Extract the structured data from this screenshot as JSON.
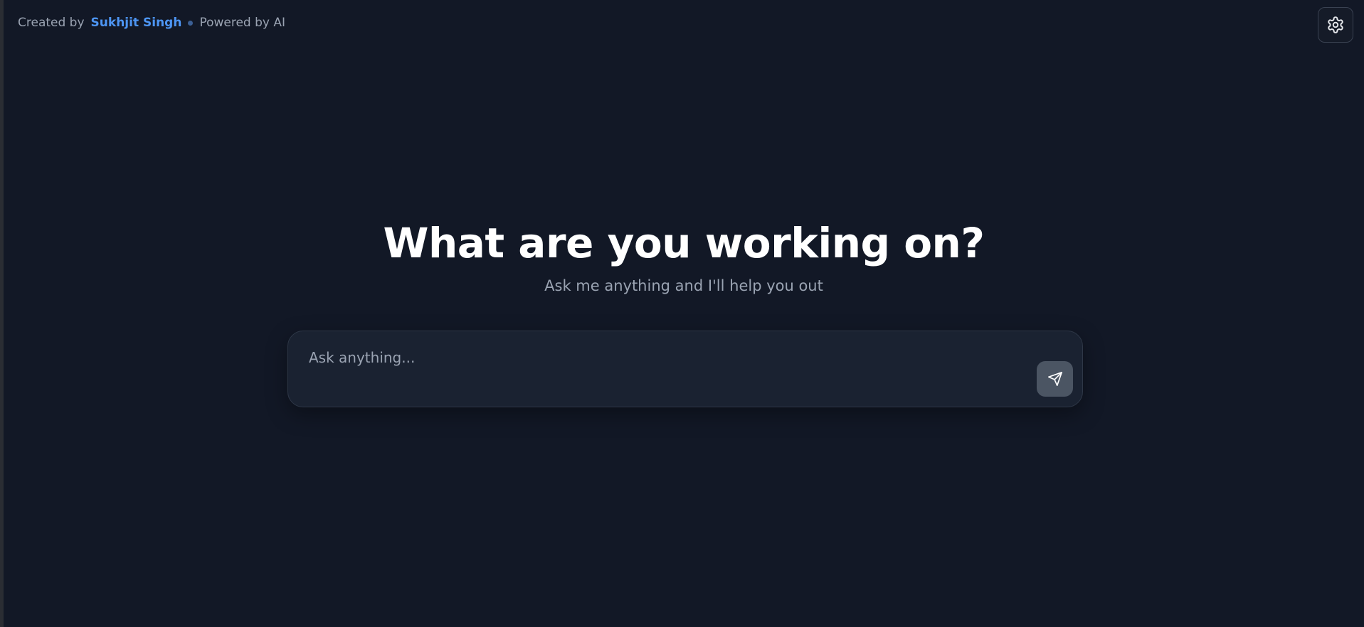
{
  "credit": {
    "created_by_label": "Created by",
    "author_name": "Sukhjit Singh",
    "powered_by_label": "Powered by AI"
  },
  "settings": {
    "icon": "gear-icon"
  },
  "hero": {
    "title": "What are you working on?",
    "subtitle": "Ask me anything and I'll help you out"
  },
  "prompt": {
    "placeholder": "Ask anything...",
    "value": "",
    "send_icon": "send-icon"
  },
  "colors": {
    "background": "#121826",
    "accent_link": "#4d95f3",
    "input_background": "#1a2231",
    "send_button": "#4b5563"
  }
}
